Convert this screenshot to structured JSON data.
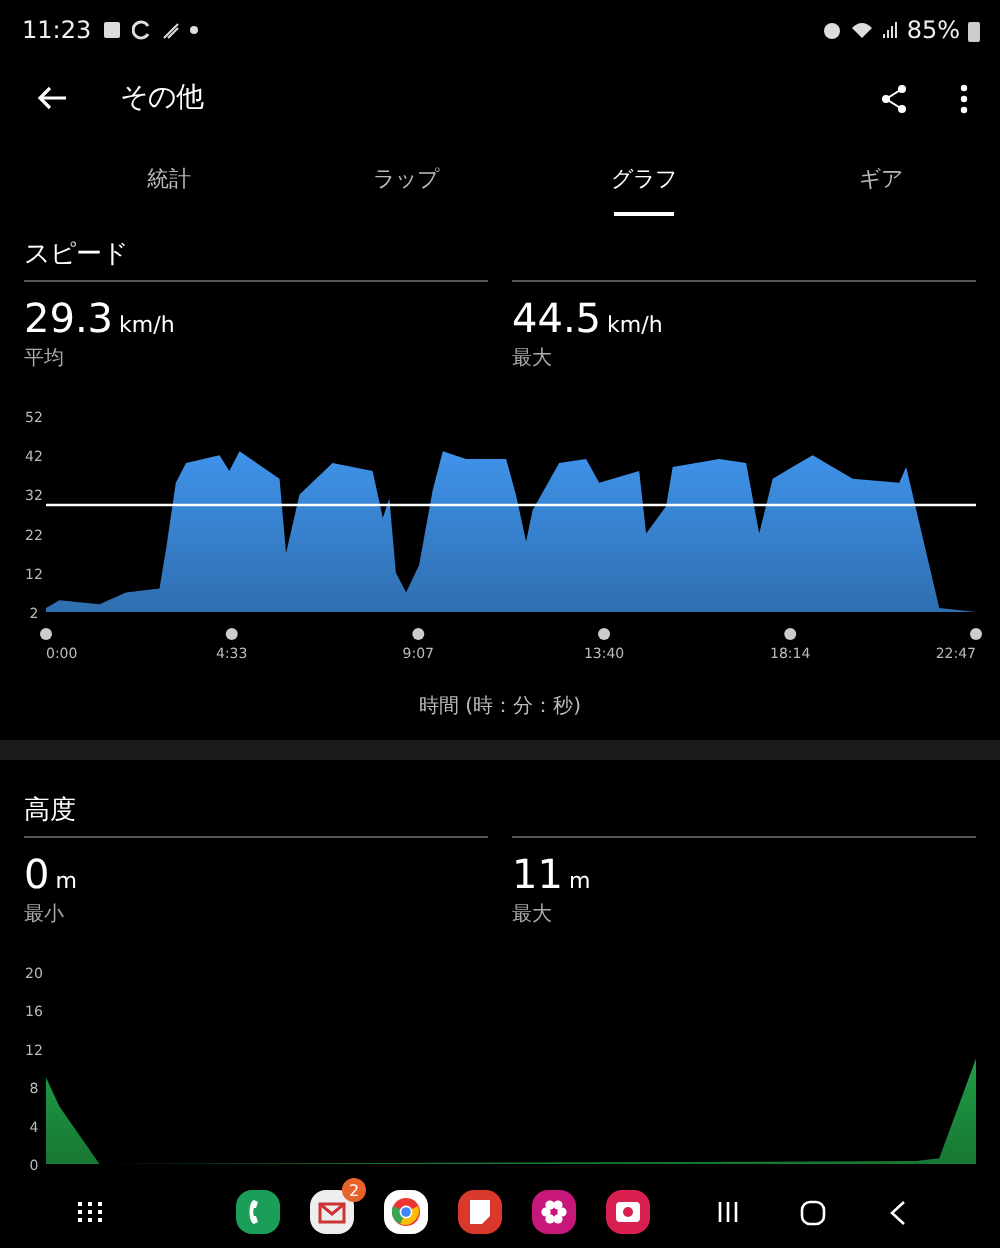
{
  "status_bar": {
    "time": "11:23",
    "battery": "85%"
  },
  "app_bar": {
    "title": "その他"
  },
  "tabs": [
    {
      "label": "統計",
      "selected": false
    },
    {
      "label": "ラップ",
      "selected": false
    },
    {
      "label": "グラフ",
      "selected": true
    },
    {
      "label": "ギア",
      "selected": false
    }
  ],
  "sections": [
    {
      "title": "スピード",
      "stats": [
        {
          "value": "29.3",
          "unit": "km/h",
          "label": "平均"
        },
        {
          "value": "44.5",
          "unit": "km/h",
          "label": "最大"
        }
      ],
      "chart_data": {
        "type": "area",
        "x": [
          0,
          0.33,
          1.31,
          1.96,
          2.78,
          2.94,
          3.18,
          3.43,
          4.25,
          4.49,
          4.74,
          5.72,
          5.88,
          6.21,
          7.02,
          8.0,
          8.25,
          8.41,
          8.57,
          8.82,
          9.14,
          9.47,
          9.72,
          10.29,
          11.27,
          11.51,
          11.76,
          11.92,
          12.57,
          13.23,
          13.55,
          14.53,
          14.7,
          15.19,
          15.35,
          16.49,
          17.15,
          17.47,
          17.8,
          18.45,
          18.78,
          19.76,
          20.9,
          21.07,
          21.88,
          22.78
        ],
        "series": [
          {
            "color": "#3f93ea",
            "values": [
              3,
              5,
              4,
              7,
              8,
              18,
              35,
              40,
              42,
              38,
              43,
              36,
              17,
              32,
              40,
              38,
              26,
              31,
              12,
              7,
              14,
              33,
              43,
              41,
              41,
              32,
              20,
              28,
              40,
              41,
              35,
              38,
              22,
              29,
              39,
              41,
              40,
              22,
              36,
              40,
              42,
              36,
              35,
              39,
              3,
              2
            ]
          }
        ],
        "xlim": [
          0,
          22.78
        ],
        "ylim": [
          2,
          52
        ],
        "yticks": [
          2,
          12,
          22,
          32,
          42,
          52
        ],
        "xticks": [
          {
            "value": 0,
            "label": "0:00"
          },
          {
            "value": 4.55,
            "label": "4:33"
          },
          {
            "value": 9.12,
            "label": "9:07"
          },
          {
            "value": 13.67,
            "label": "13:40"
          },
          {
            "value": 18.23,
            "label": "18:14"
          },
          {
            "value": 22.78,
            "label": "22:47"
          }
        ],
        "xlabel": "時間 (時：分：秒)",
        "ref_lines": [
          {
            "axis": "y",
            "value": 29.3
          }
        ]
      }
    },
    {
      "title": "高度",
      "stats": [
        {
          "value": "0",
          "unit": "m",
          "label": "最小"
        },
        {
          "value": "11",
          "unit": "m",
          "label": "最大"
        }
      ],
      "chart_data": {
        "type": "area",
        "x": [
          0,
          0.33,
          1.31,
          21.31,
          21.88,
          22.78
        ],
        "series": [
          {
            "color": "#1f9e45",
            "values": [
              9,
              6,
              0,
              0.3,
              0.6,
              11
            ]
          }
        ],
        "xlim": [
          0,
          22.78
        ],
        "ylim": [
          0,
          20
        ],
        "yticks": [
          0,
          4,
          8,
          12,
          16,
          20
        ]
      }
    }
  ],
  "nav_bar": {
    "apps": [
      {
        "kind": "phone"
      },
      {
        "kind": "mail",
        "badge": "2"
      },
      {
        "kind": "browser"
      },
      {
        "kind": "notes"
      },
      {
        "kind": "flower"
      },
      {
        "kind": "camera"
      }
    ]
  }
}
